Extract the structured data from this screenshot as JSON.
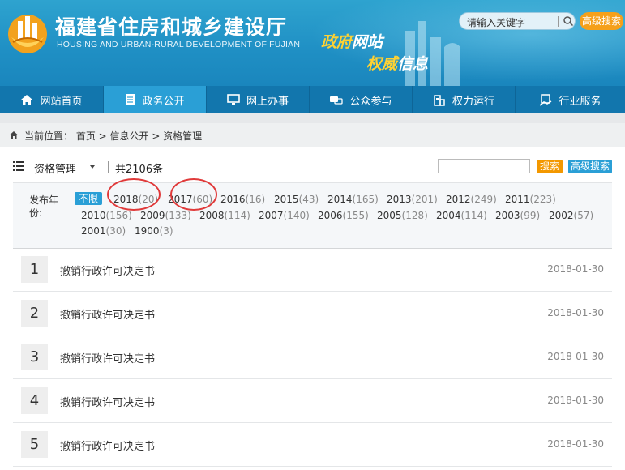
{
  "header": {
    "site_title": "福建省住房和城乡建设厅",
    "site_subtitle": "HOUSING AND URBAN-RURAL DEVELOPMENT OF FUJIAN",
    "slogan_line1_a": "政府",
    "slogan_line1_b": "网站",
    "slogan_line2_a": "权威",
    "slogan_line2_b": "信息",
    "search_placeholder": "请输入关键字",
    "advanced_search": "高级搜索",
    "logo_icon": "provincial-emblem-logo"
  },
  "nav": {
    "items": [
      {
        "label": "网站首页",
        "icon": "home-icon"
      },
      {
        "label": "政务公开",
        "icon": "document-icon"
      },
      {
        "label": "网上办事",
        "icon": "monitor-icon"
      },
      {
        "label": "公众参与",
        "icon": "chat-icon"
      },
      {
        "label": "权力运行",
        "icon": "building-icon"
      },
      {
        "label": "行业服务",
        "icon": "service-icon"
      }
    ],
    "active_index": 1
  },
  "breadcrumb": {
    "text": "当前位置： 首页 > 信息公开 > 资格管理"
  },
  "toolbar": {
    "category": "资格管理",
    "count": "共2106条",
    "search_button": "搜索",
    "advanced_button": "高级搜索"
  },
  "years": {
    "label": "发布年份:",
    "selected": "不限",
    "items": [
      {
        "year": "2018",
        "count": "(20)"
      },
      {
        "year": "2017",
        "count": "(60)"
      },
      {
        "year": "2016",
        "count": "(16)"
      },
      {
        "year": "2015",
        "count": "(43)"
      },
      {
        "year": "2014",
        "count": "(165)"
      },
      {
        "year": "2013",
        "count": "(201)"
      },
      {
        "year": "2012",
        "count": "(249)"
      },
      {
        "year": "2011",
        "count": "(223)"
      },
      {
        "year": "2010",
        "count": "(156)"
      },
      {
        "year": "2009",
        "count": "(133)"
      },
      {
        "year": "2008",
        "count": "(114)"
      },
      {
        "year": "2007",
        "count": "(140)"
      },
      {
        "year": "2006",
        "count": "(155)"
      },
      {
        "year": "2005",
        "count": "(128)"
      },
      {
        "year": "2004",
        "count": "(114)"
      },
      {
        "year": "2003",
        "count": "(99)"
      },
      {
        "year": "2002",
        "count": "(57)"
      },
      {
        "year": "2001",
        "count": "(30)"
      },
      {
        "year": "1900",
        "count": "(3)"
      }
    ],
    "highlighted": [
      "2018",
      "2017"
    ],
    "highlight_color": "#e03a3a"
  },
  "list": {
    "items": [
      {
        "num": "1",
        "title": "撤销行政许可决定书",
        "date": "2018-01-30"
      },
      {
        "num": "2",
        "title": "撤销行政许可决定书",
        "date": "2018-01-30"
      },
      {
        "num": "3",
        "title": "撤销行政许可决定书",
        "date": "2018-01-30"
      },
      {
        "num": "4",
        "title": "撤销行政许可决定书",
        "date": "2018-01-30"
      },
      {
        "num": "5",
        "title": "撤销行政许可决定书",
        "date": "2018-01-30"
      }
    ]
  },
  "colors": {
    "header_blue": "#1f8fc4",
    "nav_blue": "#1276ad",
    "nav_active": "#2a9fd6",
    "accent_orange": "#f39800",
    "slogan_yellow": "#ffd233"
  }
}
